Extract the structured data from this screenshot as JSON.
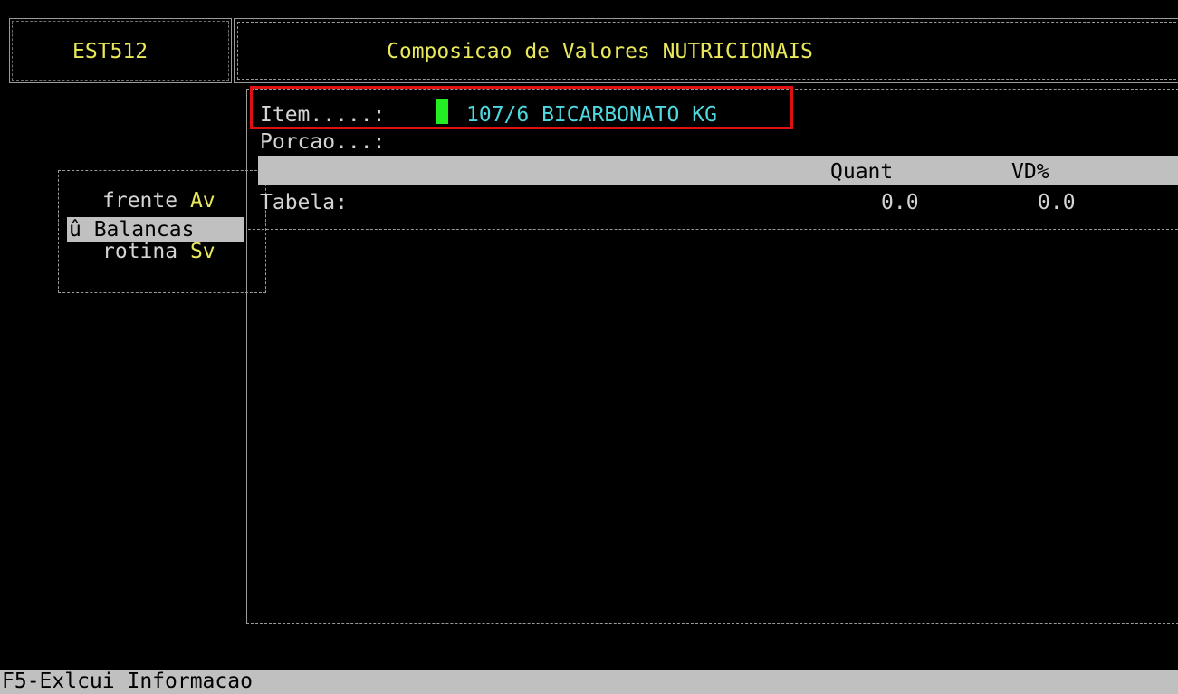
{
  "program": {
    "code": "EST512"
  },
  "menu": {
    "items": [
      {
        "text": "frente ",
        "hotkey": "Av"
      },
      {
        "text": "û Balancas",
        "hotkey": ""
      },
      {
        "text": "rotina ",
        "hotkey": "Sv"
      }
    ]
  },
  "dialog": {
    "title": "Composicao de Valores NUTRICIONAIS",
    "item_label": "Item.....:",
    "item_value": "107/6 BICARBONATO KG",
    "porcao_label": "Porcao...:",
    "columns": {
      "quant": "Quant",
      "vd": "VD%"
    },
    "tabela_label": "Tabela:",
    "tabela_quant": "0.0",
    "tabela_vd": "0.0"
  },
  "status": {
    "text": "F5-Exlcui Informacao"
  },
  "colors": {
    "title": "#e8e85a",
    "value": "#4fd8e0",
    "cursor": "#22ee22",
    "highlight": "#e01010"
  }
}
